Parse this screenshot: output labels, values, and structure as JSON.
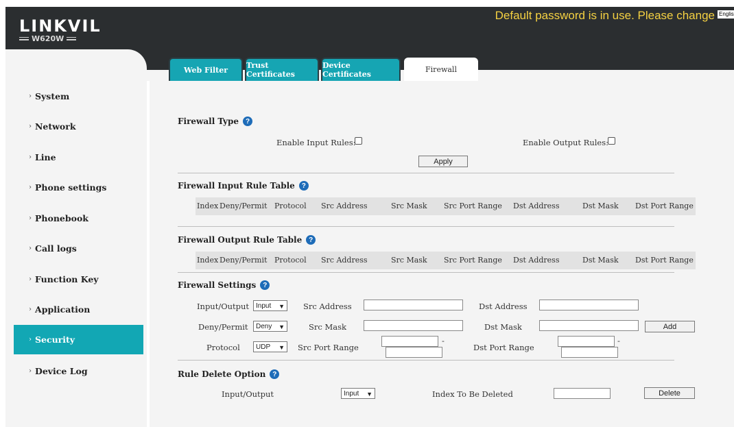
{
  "header": {
    "logo": "LINKVIL",
    "model": "W620W",
    "warning": "Default password is in use. Please change",
    "lang": "English"
  },
  "sidebar": {
    "items": [
      {
        "label": "System"
      },
      {
        "label": "Network"
      },
      {
        "label": "Line"
      },
      {
        "label": "Phone settings"
      },
      {
        "label": "Phonebook"
      },
      {
        "label": "Call logs"
      },
      {
        "label": "Function Key"
      },
      {
        "label": "Application"
      },
      {
        "label": "Security",
        "active": true
      },
      {
        "label": "Device Log"
      }
    ]
  },
  "tabs": [
    "Web Filter",
    "Trust Certificates",
    "Device Certificates",
    "Firewall"
  ],
  "active_tab": "Firewall",
  "firewall_type": {
    "title": "Firewall Type",
    "enable_input_label": "Enable Input Rules:",
    "enable_output_label": "Enable Output Rules:",
    "apply_label": "Apply"
  },
  "input_table": {
    "title": "Firewall Input Rule Table",
    "columns": [
      "Index",
      "Deny/Permit",
      "Protocol",
      "Src Address",
      "Src Mask",
      "Src Port Range",
      "Dst Address",
      "Dst Mask",
      "Dst Port Range"
    ]
  },
  "output_table": {
    "title": "Firewall Output Rule Table",
    "columns": [
      "Index",
      "Deny/Permit",
      "Protocol",
      "Src Address",
      "Src Mask",
      "Src Port Range",
      "Dst Address",
      "Dst Mask",
      "Dst Port Range"
    ]
  },
  "settings": {
    "title": "Firewall Settings",
    "io_label": "Input/Output",
    "io_value": "Input",
    "dp_label": "Deny/Permit",
    "dp_value": "Deny",
    "proto_label": "Protocol",
    "proto_value": "UDP",
    "src_address_label": "Src Address",
    "src_mask_label": "Src Mask",
    "src_port_label": "Src Port Range",
    "dst_address_label": "Dst Address",
    "dst_mask_label": "Dst Mask",
    "dst_port_label": "Dst Port Range",
    "dash": "-",
    "add_label": "Add"
  },
  "delete_option": {
    "title": "Rule Delete Option",
    "io_label": "Input/Output",
    "io_value": "Input",
    "index_label": "Index To Be Deleted",
    "delete_label": "Delete"
  },
  "colors": {
    "accent": "#12a7b4",
    "header_bg": "#2b2e30",
    "warning": "#f5d142",
    "help_icon": "#1e6cb8"
  }
}
